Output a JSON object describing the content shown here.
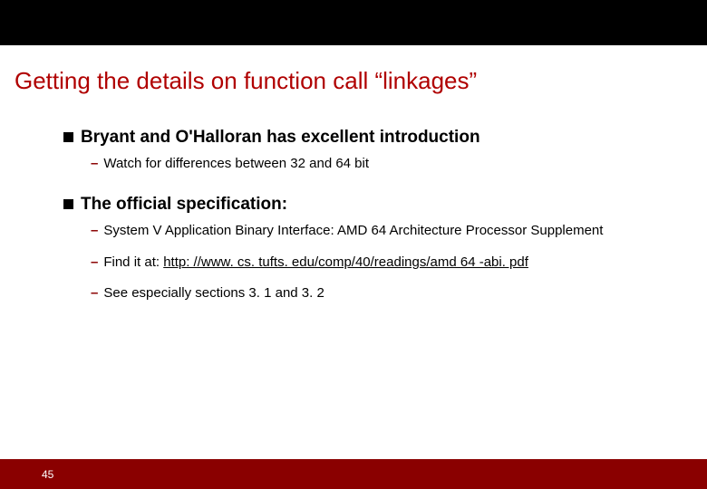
{
  "title": "Getting the details on function call “linkages”",
  "bullets": [
    {
      "text": "Bryant and O'Halloran has excellent introduction",
      "subs": [
        {
          "text": "Watch for differences between 32 and 64 bit"
        }
      ]
    },
    {
      "text": "The official specification:",
      "subs": [
        {
          "text": "System V Application Binary Interface: AMD 64 Architecture Processor Supplement"
        },
        {
          "prefix": "Find it at: ",
          "link": "http: //www. cs. tufts. edu/comp/40/readings/amd 64 -abi. pdf"
        },
        {
          "text": "See especially sections 3. 1 and 3. 2"
        }
      ]
    }
  ],
  "page_number": "45"
}
